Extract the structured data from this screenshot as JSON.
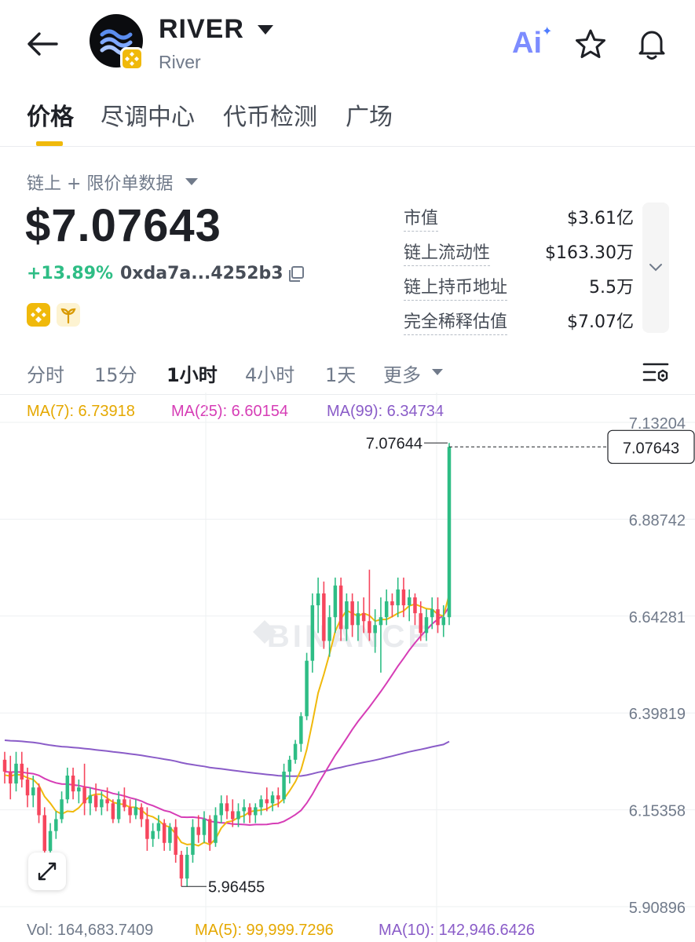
{
  "header": {
    "title": "RIVER",
    "subtitle": "River",
    "ai_label": "Ai"
  },
  "tabs": [
    {
      "label": "价格",
      "active": true
    },
    {
      "label": "尽调中心",
      "active": false
    },
    {
      "label": "代币检测",
      "active": false
    },
    {
      "label": "广场",
      "active": false
    }
  ],
  "price_block": {
    "source_label": "链上 + 限价单数据",
    "price": "$7.07643",
    "change": "+13.89%",
    "address": "0xda7a...4252b3"
  },
  "stats": [
    {
      "label": "市值",
      "value": "$3.61亿"
    },
    {
      "label": "链上流动性",
      "value": "$163.30万"
    },
    {
      "label": "链上持币地址",
      "value": "5.5万"
    },
    {
      "label": "完全稀释估值",
      "value": "$7.07亿"
    }
  ],
  "intervals": [
    {
      "label": "分时",
      "active": false
    },
    {
      "label": "15分",
      "active": false
    },
    {
      "label": "1小时",
      "active": true
    },
    {
      "label": "4小时",
      "active": false
    },
    {
      "label": "1天",
      "active": false
    },
    {
      "label": "更多",
      "active": false
    }
  ],
  "ma_legend": {
    "ma7": "MA(7): 6.73918",
    "ma25": "MA(25): 6.60154",
    "ma99": "MA(99): 6.34734"
  },
  "volume": {
    "vol": "Vol: 164,683.7409",
    "ma5": "MA(5): 99,999.7296",
    "ma10": "MA(10): 142,946.6426"
  },
  "colors": {
    "up": "#2ebd85",
    "down": "#f6465d",
    "ma7": "#f0b90b",
    "ma25": "#d63db6",
    "ma99": "#8a5cc8",
    "accent": "#f0b90b"
  },
  "chart_data": {
    "type": "candlestick",
    "y_ticks": [
      "7.13204",
      "6.88742",
      "6.64281",
      "6.39819",
      "6.15358",
      "5.90896"
    ],
    "ylim": [
      5.90896,
      7.13204
    ],
    "last_price_label": "7.07643",
    "high_label": "7.07644",
    "low_label": "5.96455",
    "watermark": "BINANCE",
    "candles": [
      [
        6.28,
        6.3,
        6.22,
        6.25
      ],
      [
        6.25,
        6.29,
        6.18,
        6.22
      ],
      [
        6.22,
        6.3,
        6.2,
        6.27
      ],
      [
        6.27,
        6.3,
        6.21,
        6.23
      ],
      [
        6.23,
        6.26,
        6.16,
        6.19
      ],
      [
        6.19,
        6.24,
        6.16,
        6.21
      ],
      [
        6.21,
        6.22,
        6.12,
        6.14
      ],
      [
        6.14,
        6.16,
        6.02,
        6.05
      ],
      [
        6.05,
        6.12,
        6.03,
        6.1
      ],
      [
        6.1,
        6.15,
        6.08,
        6.13
      ],
      [
        6.13,
        6.2,
        6.12,
        6.18
      ],
      [
        6.18,
        6.26,
        6.17,
        6.24
      ],
      [
        6.24,
        6.26,
        6.18,
        6.2
      ],
      [
        6.2,
        6.23,
        6.17,
        6.21
      ],
      [
        6.21,
        6.27,
        6.14,
        6.17
      ],
      [
        6.17,
        6.21,
        6.14,
        6.19
      ],
      [
        6.19,
        6.22,
        6.15,
        6.16
      ],
      [
        6.16,
        6.2,
        6.14,
        6.18
      ],
      [
        6.18,
        6.21,
        6.15,
        6.17
      ],
      [
        6.17,
        6.18,
        6.12,
        6.13
      ],
      [
        6.13,
        6.2,
        6.12,
        6.18
      ],
      [
        6.18,
        6.21,
        6.15,
        6.16
      ],
      [
        6.16,
        6.18,
        6.12,
        6.14
      ],
      [
        6.14,
        6.18,
        6.13,
        6.16
      ],
      [
        6.16,
        6.17,
        6.11,
        6.13
      ],
      [
        6.13,
        6.16,
        6.05,
        6.08
      ],
      [
        6.08,
        6.12,
        6.06,
        6.1
      ],
      [
        6.1,
        6.14,
        6.08,
        6.12
      ],
      [
        6.12,
        6.13,
        6.05,
        6.07
      ],
      [
        6.07,
        6.12,
        6.05,
        6.11
      ],
      [
        6.11,
        6.13,
        6.02,
        6.04
      ],
      [
        6.04,
        6.05,
        5.96,
        5.98
      ],
      [
        5.98,
        6.06,
        5.96,
        6.04
      ],
      [
        6.04,
        6.13,
        6.02,
        6.11
      ],
      [
        6.11,
        6.14,
        6.07,
        6.09
      ],
      [
        6.09,
        6.15,
        6.07,
        6.13
      ],
      [
        6.13,
        6.14,
        6.05,
        6.07
      ],
      [
        6.07,
        6.16,
        6.06,
        6.14
      ],
      [
        6.14,
        6.19,
        6.12,
        6.17
      ],
      [
        6.17,
        6.19,
        6.13,
        6.15
      ],
      [
        6.15,
        6.18,
        6.11,
        6.13
      ],
      [
        6.13,
        6.17,
        6.11,
        6.15
      ],
      [
        6.15,
        6.18,
        6.12,
        6.16
      ],
      [
        6.16,
        6.17,
        6.12,
        6.14
      ],
      [
        6.14,
        6.17,
        6.12,
        6.16
      ],
      [
        6.16,
        6.19,
        6.14,
        6.18
      ],
      [
        6.18,
        6.21,
        6.15,
        6.17
      ],
      [
        6.17,
        6.2,
        6.15,
        6.19
      ],
      [
        6.19,
        6.21,
        6.16,
        6.18
      ],
      [
        6.18,
        6.27,
        6.17,
        6.25
      ],
      [
        6.25,
        6.29,
        6.22,
        6.28
      ],
      [
        6.28,
        6.33,
        6.27,
        6.32
      ],
      [
        6.32,
        6.4,
        6.3,
        6.39
      ],
      [
        6.39,
        6.55,
        6.38,
        6.53
      ],
      [
        6.53,
        6.7,
        6.5,
        6.67
      ],
      [
        6.67,
        6.74,
        6.6,
        6.7
      ],
      [
        6.7,
        6.73,
        6.56,
        6.58
      ],
      [
        6.58,
        6.67,
        6.54,
        6.64
      ],
      [
        6.64,
        6.74,
        6.6,
        6.72
      ],
      [
        6.72,
        6.74,
        6.58,
        6.61
      ],
      [
        6.61,
        6.7,
        6.58,
        6.68
      ],
      [
        6.68,
        6.7,
        6.59,
        6.62
      ],
      [
        6.62,
        6.68,
        6.58,
        6.65
      ],
      [
        6.65,
        6.69,
        6.6,
        6.63
      ],
      [
        6.63,
        6.76,
        6.58,
        6.6
      ],
      [
        6.6,
        6.66,
        6.55,
        6.62
      ],
      [
        6.62,
        6.69,
        6.5,
        6.64
      ],
      [
        6.64,
        6.71,
        6.62,
        6.68
      ],
      [
        6.68,
        6.7,
        6.64,
        6.67
      ],
      [
        6.67,
        6.74,
        6.64,
        6.71
      ],
      [
        6.71,
        6.74,
        6.64,
        6.67
      ],
      [
        6.67,
        6.71,
        6.63,
        6.69
      ],
      [
        6.69,
        6.7,
        6.62,
        6.65
      ],
      [
        6.65,
        6.68,
        6.58,
        6.6
      ],
      [
        6.6,
        6.66,
        6.58,
        6.64
      ],
      [
        6.64,
        6.69,
        6.61,
        6.66
      ],
      [
        6.66,
        6.69,
        6.6,
        6.62
      ],
      [
        6.62,
        6.67,
        6.59,
        6.64
      ],
      [
        6.64,
        7.08,
        6.62,
        7.07
      ]
    ]
  }
}
